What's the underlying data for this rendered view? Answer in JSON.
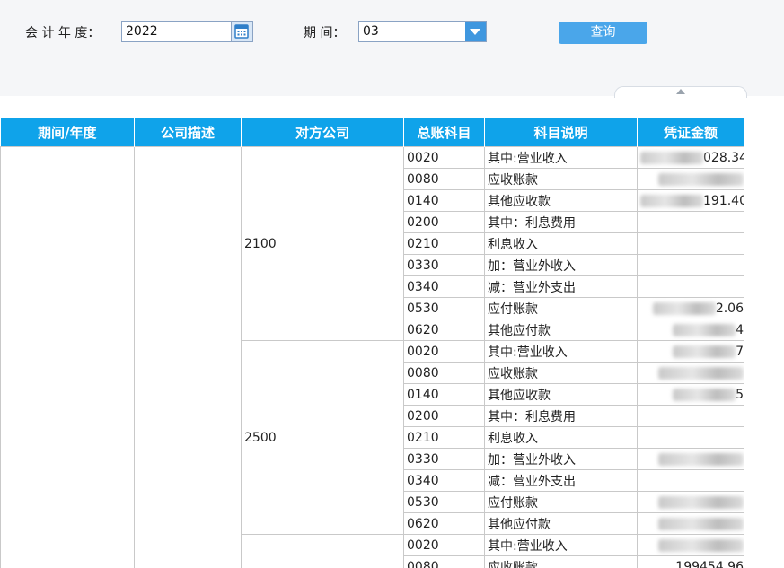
{
  "filters": {
    "year_label": "会 计 年 度：",
    "year_value": "2022",
    "period_label": "期 间：",
    "period_value": "03",
    "query_button": "查询"
  },
  "table": {
    "headers": [
      "期间/年度",
      "公司描述",
      "对方公司",
      "总账科目",
      "科目说明",
      "凭证金额"
    ],
    "groups": [
      {
        "counterparty": "2100",
        "rows": [
          {
            "code": "0020",
            "desc": "其中:营业收入",
            "amount": "028.34",
            "blurred": true
          },
          {
            "code": "0080",
            "desc": "应收账款",
            "amount": "",
            "blurred": true
          },
          {
            "code": "0140",
            "desc": "其他应收款",
            "amount": "191.40",
            "blurred": true
          },
          {
            "code": "0200",
            "desc": "其中：利息费用",
            "amount": "",
            "blurred": false
          },
          {
            "code": "0210",
            "desc": "利息收入",
            "amount": "",
            "blurred": false
          },
          {
            "code": "0330",
            "desc": "加：营业外收入",
            "amount": "",
            "blurred": false
          },
          {
            "code": "0340",
            "desc": "减：营业外支出",
            "amount": "",
            "blurred": false
          },
          {
            "code": "0530",
            "desc": "应付账款",
            "amount": "2.06",
            "blurred": true
          },
          {
            "code": "0620",
            "desc": "其他应付款",
            "amount": "4",
            "blurred": true
          }
        ]
      },
      {
        "counterparty": "2500",
        "rows": [
          {
            "code": "0020",
            "desc": "其中:营业收入",
            "amount": "7",
            "blurred": true
          },
          {
            "code": "0080",
            "desc": "应收账款",
            "amount": "",
            "blurred": true
          },
          {
            "code": "0140",
            "desc": "其他应收款",
            "amount": "5",
            "blurred": true
          },
          {
            "code": "0200",
            "desc": "其中：利息费用",
            "amount": "",
            "blurred": false
          },
          {
            "code": "0210",
            "desc": "利息收入",
            "amount": "",
            "blurred": false
          },
          {
            "code": "0330",
            "desc": "加：营业外收入",
            "amount": "",
            "blurred": true
          },
          {
            "code": "0340",
            "desc": "减：营业外支出",
            "amount": "",
            "blurred": false
          },
          {
            "code": "0530",
            "desc": "应付账款",
            "amount": "",
            "blurred": true
          },
          {
            "code": "0620",
            "desc": "其他应付款",
            "amount": "",
            "blurred": true
          }
        ]
      },
      {
        "counterparty": "",
        "rows": [
          {
            "code": "0020",
            "desc": "其中:营业收入",
            "amount": "",
            "blurred": true
          },
          {
            "code": "0080",
            "desc": "应收账款",
            "amount": "199454.96",
            "blurred": false
          }
        ]
      }
    ]
  },
  "icons": {
    "calendar": "calendar-icon",
    "dropdown": "chevron-down-icon",
    "collapse": "chevron-up-icon"
  },
  "colors": {
    "header_bg": "#0fa3ea",
    "button_bg": "#4aa6ea",
    "toolbar_bg": "#f5f6f8"
  }
}
